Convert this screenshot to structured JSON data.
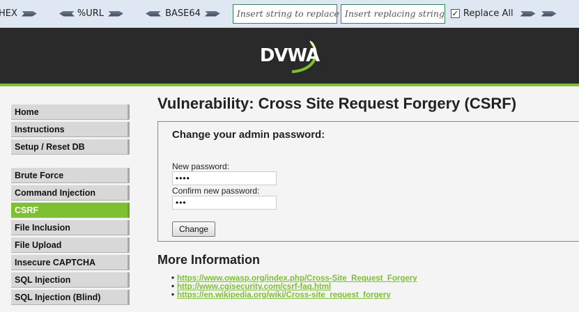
{
  "toolbar": {
    "hex_label": "HEX",
    "url_label": "%URL",
    "base64_label": "BASE64",
    "find_placeholder": "Insert string to replace",
    "replace_placeholder": "Insert replacing string",
    "replace_all_label": "Replace All",
    "replace_all_checked": true
  },
  "header": {
    "logo_text": "DVWA"
  },
  "menu": {
    "group1": [
      "Home",
      "Instructions",
      "Setup / Reset DB"
    ],
    "group2": [
      "Brute Force",
      "Command Injection",
      "CSRF",
      "File Inclusion",
      "File Upload",
      "Insecure CAPTCHA",
      "SQL Injection",
      "SQL Injection (Blind)"
    ],
    "active": "CSRF"
  },
  "main": {
    "title": "Vulnerability: Cross Site Request Forgery (CSRF)",
    "form_title": "Change your admin password:",
    "new_password_label": "New password:",
    "new_password_value": "••••",
    "confirm_password_label": "Confirm new password:",
    "confirm_password_value": "•••",
    "change_button": "Change",
    "more_info_title": "More Information",
    "links": [
      "https://www.owasp.org/index.php/Cross-Site_Request_Forgery",
      "http://www.cgisecurity.com/csrf-faq.html",
      "https://en.wikipedia.org/wiki/Cross-site_request_forgery"
    ]
  },
  "colors": {
    "accent": "#7fbf32",
    "header_bg": "#2a2a2a",
    "page_bg": "#f4f4f4"
  }
}
